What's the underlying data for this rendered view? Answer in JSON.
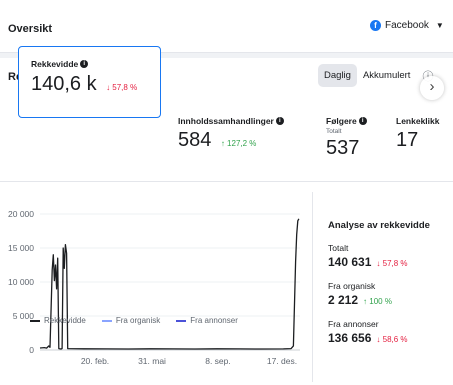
{
  "header": {
    "title": "Oversikt",
    "source": {
      "label": "Facebook",
      "icon": "facebook-icon"
    }
  },
  "results": {
    "title": "Resultat",
    "tabs": [
      {
        "label": "Daglig",
        "active": true
      },
      {
        "label": "Akkumulert",
        "active": false
      }
    ],
    "metrics": [
      {
        "label": "Rekkevidde",
        "value": "140,6 k",
        "change": "↓ 57,8 %",
        "direction": "down"
      },
      {
        "label": "Innholdssamhandlinger",
        "value": "584",
        "change": "↑ 127,2 %",
        "direction": "up"
      },
      {
        "label": "Følgere",
        "sub": "Totalt",
        "value": "537"
      },
      {
        "label": "Lenkeklikk",
        "value": "17"
      }
    ]
  },
  "chart_data": {
    "type": "line",
    "y_ticks": [
      "20 000",
      "15 000",
      "10 000",
      "5 000",
      "0"
    ],
    "x_ticks": [
      "20. feb.",
      "31. mai",
      "8. sep.",
      "17. des."
    ],
    "ylim": [
      0,
      20000
    ],
    "series": [
      {
        "name": "Rekkevidde",
        "color": "#1c1e21",
        "points": [
          [
            0,
            300
          ],
          [
            4,
            350
          ],
          [
            6,
            280
          ],
          [
            8,
            600
          ],
          [
            9,
            400
          ],
          [
            11,
            11800
          ],
          [
            12,
            14000
          ],
          [
            13,
            10200
          ],
          [
            14,
            12500
          ],
          [
            15,
            9000
          ],
          [
            16,
            13500
          ],
          [
            17,
            200
          ],
          [
            19,
            150
          ],
          [
            20,
            220
          ],
          [
            21,
            15000
          ],
          [
            22,
            12000
          ],
          [
            23,
            15500
          ],
          [
            24,
            14200
          ],
          [
            25,
            200
          ],
          [
            40,
            180
          ],
          [
            60,
            160
          ],
          [
            80,
            150
          ],
          [
            100,
            170
          ],
          [
            120,
            160
          ],
          [
            140,
            150
          ],
          [
            160,
            170
          ],
          [
            180,
            160
          ],
          [
            200,
            150
          ],
          [
            220,
            160
          ],
          [
            227,
            200
          ],
          [
            229,
            600
          ],
          [
            231,
            13000
          ],
          [
            232,
            17000
          ],
          [
            233,
            19000
          ],
          [
            234,
            19300
          ]
        ]
      },
      {
        "name": "Fra organisk",
        "color": "#8aa4ff",
        "points": []
      },
      {
        "name": "Fra annonser",
        "color": "#4b52d8",
        "points": []
      }
    ]
  },
  "analysis": {
    "title": "Analyse av rekkevidde",
    "rows": [
      {
        "label": "Totalt",
        "value": "140 631",
        "change": "↓ 57,8 %",
        "direction": "down"
      },
      {
        "label": "Fra organisk",
        "value": "2 212",
        "change": "↑ 100 %",
        "direction": "up"
      },
      {
        "label": "Fra annonser",
        "value": "136 656",
        "change": "↓ 58,6 %",
        "direction": "down"
      }
    ]
  },
  "colors": {
    "accent": "#1877f2",
    "down": "#e41e3f",
    "up": "#31a24c"
  }
}
